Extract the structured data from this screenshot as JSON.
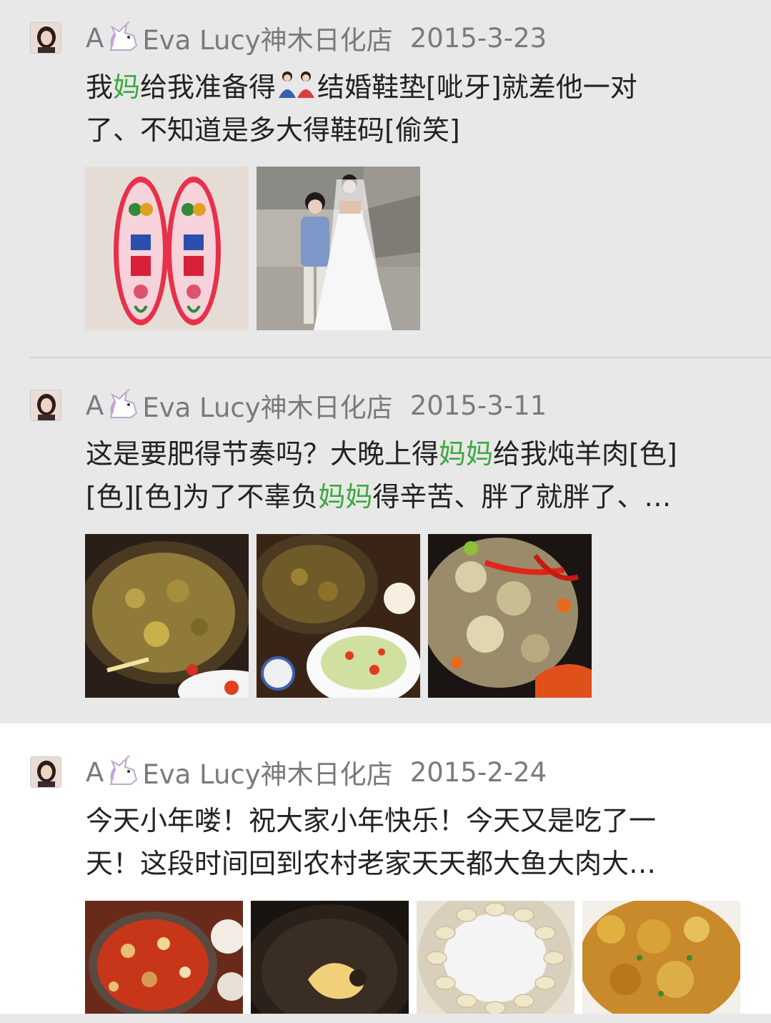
{
  "posts": [
    {
      "name_prefix": "A",
      "name_suffix": "Eva Lucy神木日化店",
      "date": "2015-3-23",
      "text_line1_a": "我",
      "text_line1_hl": "妈",
      "text_line1_b": "给我准备得",
      "text_line1_c": "结婚鞋垫[呲牙]就差他一对",
      "text_line2": "了、不知道是多大得鞋码[偷笑]"
    },
    {
      "name_prefix": "A",
      "name_suffix": "Eva Lucy神木日化店",
      "date": "2015-3-11",
      "text_line1_a": "这是要肥得节奏吗？大晚上得",
      "text_line1_hl": "妈妈",
      "text_line1_b": "给我炖羊肉[色]",
      "text_line2_a": "[色][色]为了不辜负",
      "text_line2_hl": "妈妈",
      "text_line2_b": "得辛苦、胖了就胖了、…"
    },
    {
      "name_prefix": "A",
      "name_suffix": "Eva Lucy神木日化店",
      "date": "2015-2-24",
      "text_line1": "今天小年喽！祝大家小年快乐！今天又是吃了一",
      "text_line2": "天！这段时间回到农村老家天天都大鱼大肉大…"
    }
  ],
  "colors": {
    "highlight": "#3da83d",
    "meta": "#7a7a7a",
    "text": "#222222"
  },
  "icons": [
    "unicorn-emoji",
    "couple-dolls-emoji",
    "avatar-photo"
  ]
}
